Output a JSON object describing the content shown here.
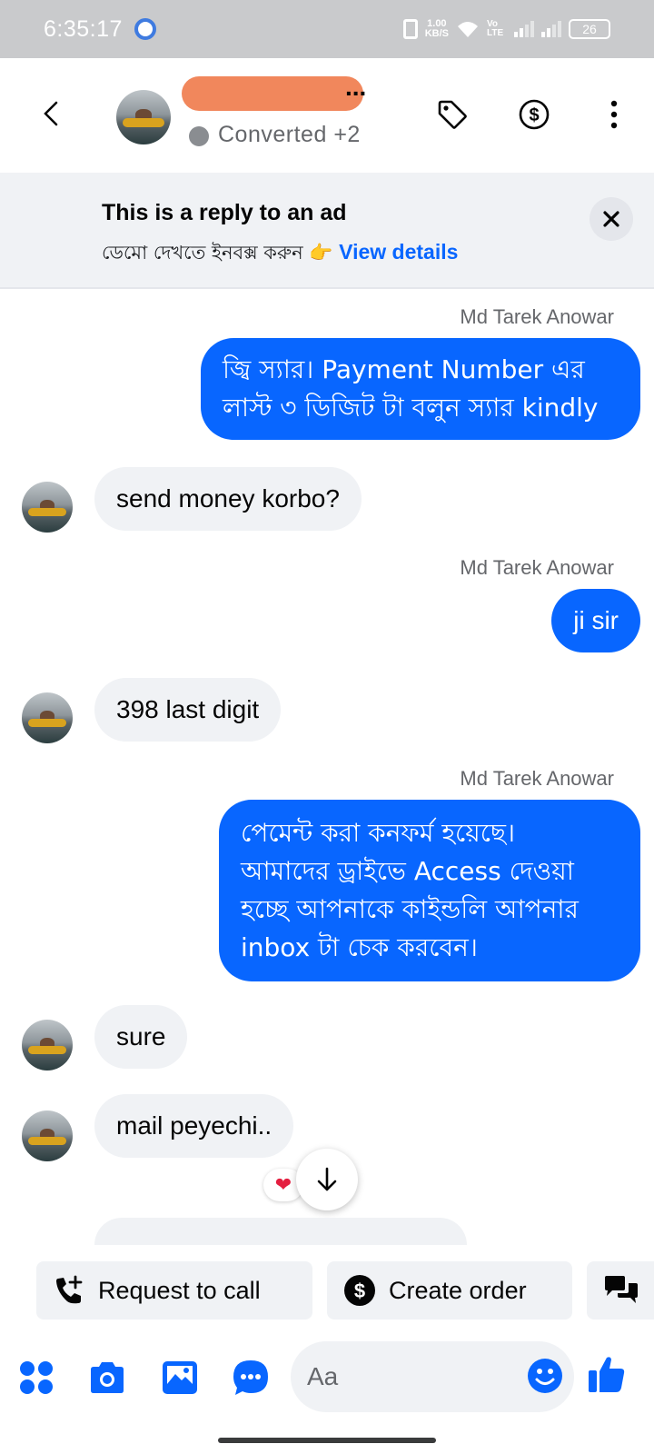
{
  "status_bar": {
    "time": "6:35:17",
    "net_speed": "1.00",
    "net_unit": "KB/S",
    "volte": "Vo LTE",
    "battery": "26"
  },
  "header": {
    "contact_name": "",
    "name_suffix": "...",
    "status_label": "Converted",
    "status_extra": "+2"
  },
  "ad_banner": {
    "title": "This is a reply to an ad",
    "subtitle": "ডেমো দেখতে ইনবক্স করুন 👉",
    "link": "View details"
  },
  "messages": [
    {
      "dir": "out",
      "sender": "Md Tarek Anowar",
      "lines": [
        "জ্বি স্যার। Payment Number এর",
        "লাস্ট ৩ ডিজিট টা বলুন স্যার kindly"
      ]
    },
    {
      "dir": "in",
      "text": "send money korbo?"
    },
    {
      "dir": "out",
      "sender": "Md Tarek Anowar",
      "lines": [
        "ji sir"
      ]
    },
    {
      "dir": "in",
      "text": "398 last digit"
    },
    {
      "dir": "out",
      "sender": "Md Tarek Anowar",
      "lines": [
        "পেমেন্ট করা কনফর্ম হয়েছে।",
        "আমাদের ড্রাইভে Access দেওয়া",
        "হচ্ছে আপনাকে কাইন্ডলি আপনার",
        "inbox টা চেক করবেন।"
      ]
    },
    {
      "dir": "in",
      "text": "sure"
    },
    {
      "dir": "in",
      "text": "mail peyechi.."
    }
  ],
  "reaction": "❤",
  "quick_actions": {
    "request_call": "Request to call",
    "create_order": "Create order"
  },
  "composer": {
    "placeholder": "Aa"
  },
  "colors": {
    "accent": "#0866ff",
    "bubble_in": "#f0f2f5",
    "statusbar": "#c9cacc"
  }
}
